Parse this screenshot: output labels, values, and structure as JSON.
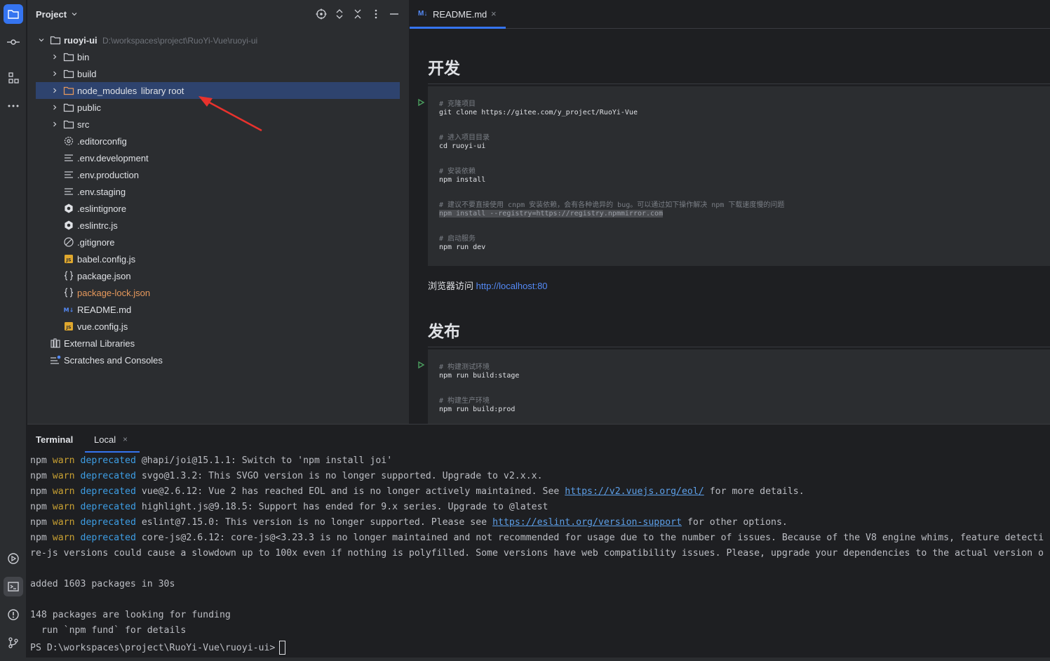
{
  "project_panel": {
    "title": "Project",
    "root": {
      "name": "ruoyi-ui",
      "path": "D:\\workspaces\\project\\RuoYi-Vue\\ruoyi-ui"
    },
    "folders": [
      {
        "name": "bin"
      },
      {
        "name": "build"
      },
      {
        "name": "node_modules",
        "hint": "library root"
      },
      {
        "name": "public"
      },
      {
        "name": "src"
      }
    ],
    "files": [
      {
        "name": ".editorconfig",
        "icon": "gear-icon"
      },
      {
        "name": ".env.development",
        "icon": "text-lines-icon"
      },
      {
        "name": ".env.production",
        "icon": "text-lines-icon"
      },
      {
        "name": ".env.staging",
        "icon": "text-lines-icon"
      },
      {
        "name": ".eslintignore",
        "icon": "eslint-icon"
      },
      {
        "name": ".eslintrc.js",
        "icon": "eslint-icon"
      },
      {
        "name": ".gitignore",
        "icon": "ignore-icon"
      },
      {
        "name": "babel.config.js",
        "icon": "js-file-icon"
      },
      {
        "name": "package.json",
        "icon": "json-icon"
      },
      {
        "name": "package-lock.json",
        "icon": "json-icon"
      },
      {
        "name": "README.md",
        "icon": "markdown-icon"
      },
      {
        "name": "vue.config.js",
        "icon": "js-file-icon"
      }
    ],
    "external_libraries": "External Libraries",
    "scratches": "Scratches and Consoles"
  },
  "editor": {
    "tab": {
      "icon_text": "M↓",
      "label": "README.md",
      "close": "×"
    },
    "sections": {
      "dev_heading": "开发",
      "dev_code": [
        {
          "comment": "# 克隆项目",
          "cmd": "git clone https://gitee.com/y_project/RuoYi-Vue"
        },
        {
          "comment": "# 进入项目目录",
          "cmd": "cd ruoyi-ui"
        },
        {
          "comment": "# 安装依赖",
          "cmd": "npm install"
        },
        {
          "comment": "# 建议不要直接使用 cnpm 安装依赖，会有各种诡异的 bug。可以通过如下操作解决 npm 下载速度慢的问题",
          "cmd": "npm install --registry=https://registry.npmmirror.com"
        },
        {
          "comment": "# 启动服务",
          "cmd": "npm run dev"
        }
      ],
      "browser_text": "浏览器访问 ",
      "browser_link": "http://localhost:80",
      "publish_heading": "发布",
      "publish_code": [
        {
          "comment": "# 构建测试环境",
          "cmd": "npm run build:stage"
        },
        {
          "comment": "# 构建生产环境",
          "cmd": "npm run build:prod"
        }
      ]
    }
  },
  "terminal": {
    "title": "Terminal",
    "tab": "Local",
    "tab_close": "×",
    "warn_lines": [
      {
        "npm": "npm",
        "warn": "warn",
        "dep": "deprecated",
        "text": "@hapi/joi@15.1.1: Switch to 'npm install joi'",
        "link": "",
        "after": ""
      },
      {
        "npm": "npm",
        "warn": "warn",
        "dep": "deprecated",
        "text": "svgo@1.3.2: This SVGO version is no longer supported. Upgrade to v2.x.x.",
        "link": "",
        "after": ""
      },
      {
        "npm": "npm",
        "warn": "warn",
        "dep": "deprecated",
        "text": "vue@2.6.12: Vue 2 has reached EOL and is no longer actively maintained. See ",
        "link": "https://v2.vuejs.org/eol/",
        "after": " for more details."
      },
      {
        "npm": "npm",
        "warn": "warn",
        "dep": "deprecated",
        "text": "highlight.js@9.18.5: Support has ended for 9.x series. Upgrade to @latest",
        "link": "",
        "after": ""
      },
      {
        "npm": "npm",
        "warn": "warn",
        "dep": "deprecated",
        "text": "eslint@7.15.0: This version is no longer supported. Please see ",
        "link": "https://eslint.org/version-support",
        "after": " for other options."
      },
      {
        "npm": "npm",
        "warn": "warn",
        "dep": "deprecated",
        "text": "core-js@2.6.12: core-js@<3.23.3 is no longer maintained and not recommended for usage due to the number of issues. Because of the V8 engine whims, feature detecti",
        "link": "",
        "after": ""
      }
    ],
    "wrap_line": "re-js versions could cause a slowdown up to 100x even if nothing is polyfilled. Some versions have web compatibility issues. Please, upgrade your dependencies to the actual version o",
    "added_line": "added 1603 packages in 30s",
    "funding_line": "148 packages are looking for funding",
    "fund_hint": "  run `npm fund` for details",
    "prompt": "PS D:\\workspaces\\project\\RuoYi-Vue\\ruoyi-ui>"
  },
  "colors": {
    "accent": "#3574f0",
    "selection": "#2e436e",
    "warn": "#c8a032",
    "deprecated": "#3d9ee5",
    "annotation_arrow": "#e8322d"
  }
}
